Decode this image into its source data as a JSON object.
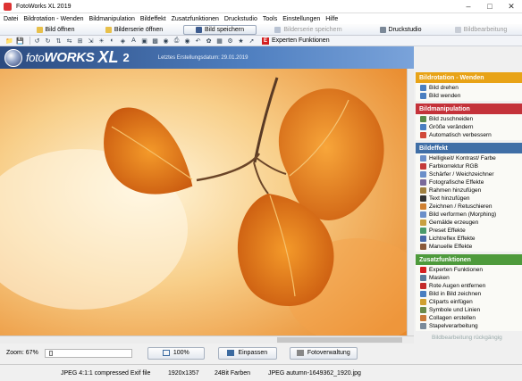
{
  "window": {
    "title": "FotoWorks XL 2019"
  },
  "menu": [
    "Datei",
    "Bildrotation - Wenden",
    "Bildmanipulation",
    "Bildeffekt",
    "Zusatzfunktionen",
    "Druckstudio",
    "Tools",
    "Einstellungen",
    "Hilfe"
  ],
  "actionbar": [
    {
      "label": "Bild öffnen",
      "state": "normal"
    },
    {
      "label": "Bilderserie öffnen",
      "state": "normal"
    },
    {
      "label": "Bild speichern",
      "state": "active"
    },
    {
      "label": "Bilderserie speichern",
      "state": "disabled"
    },
    {
      "label": "Druckstudio",
      "state": "normal"
    },
    {
      "label": "Bildbearbeitung",
      "state": "disabled"
    }
  ],
  "toolbar": {
    "icons": [
      "open-icon",
      "save-icon",
      "rotate-left-icon",
      "rotate-right-icon",
      "rotate-180-icon",
      "flip-icon",
      "crop-icon",
      "resize-icon",
      "brightness-icon",
      "color-icon",
      "sharpen-icon",
      "text-icon",
      "frame-icon",
      "image-in-image-icon",
      "mask-icon",
      "print-icon",
      "red-eye-icon",
      "undo-icon",
      "clipart-icon",
      "gallery-icon",
      "settings-icon",
      "star-icon",
      "export-icon"
    ],
    "expert_label": "Experten Funktionen",
    "expert_badge": "E"
  },
  "brand": {
    "name_bold": "foto",
    "name_rest": "WORKS",
    "xl": "XL",
    "version": "2",
    "created_label": "Letztes Erstellungsdatum: 29.01.2019"
  },
  "zoom": {
    "label": "Zoom: 67%",
    "buttons": [
      "100%",
      "Einpassen",
      "Fotoverwaltung"
    ]
  },
  "status": {
    "format": "JPEG 4:1:1 compressed Exif file",
    "size": "1920x1357",
    "depth": "24Bit Farben",
    "file": "JPEG autumn-1649362_1920.jpg"
  },
  "sidebar": {
    "groups": [
      {
        "title": "Bildrotation - Wenden",
        "color": "#e8a317",
        "items": [
          "Bild drehen",
          "Bild wenden"
        ]
      },
      {
        "title": "Bildmanipulation",
        "color": "#c4323a",
        "items": [
          "Bild zuschneiden",
          "Größe verändern",
          "Automatisch verbessern"
        ]
      },
      {
        "title": "Bildeffekt",
        "color": "#3f6ea6",
        "items": [
          "Helligkeit/ Kontrast/ Farbe",
          "Farbkorrektur RGB",
          "Schärfer / Weichzeichner",
          "Fotografische Effekte",
          "Rahmen hinzufügen",
          "Text hinzufügen",
          "Zeichnen / Retuschieren",
          "Bild verformen (Morphing)",
          "Gemälde erzeugen",
          "Preset Effekte",
          "Lichtreflex Effekte",
          "Manuelle Effekte"
        ]
      },
      {
        "title": "Zusatzfunktionen",
        "color": "#4e9a3c",
        "items": [
          "Experten Funktionen",
          "Masken",
          "Rote Augen entfernen",
          "Bild in Bild zeichnen",
          "Cliparts einfügen",
          "Symbole und Linien",
          "Collagen erstellen",
          "Stapelverarbeitung"
        ]
      }
    ],
    "footer": "Bildbearbeitung rückgängig"
  }
}
